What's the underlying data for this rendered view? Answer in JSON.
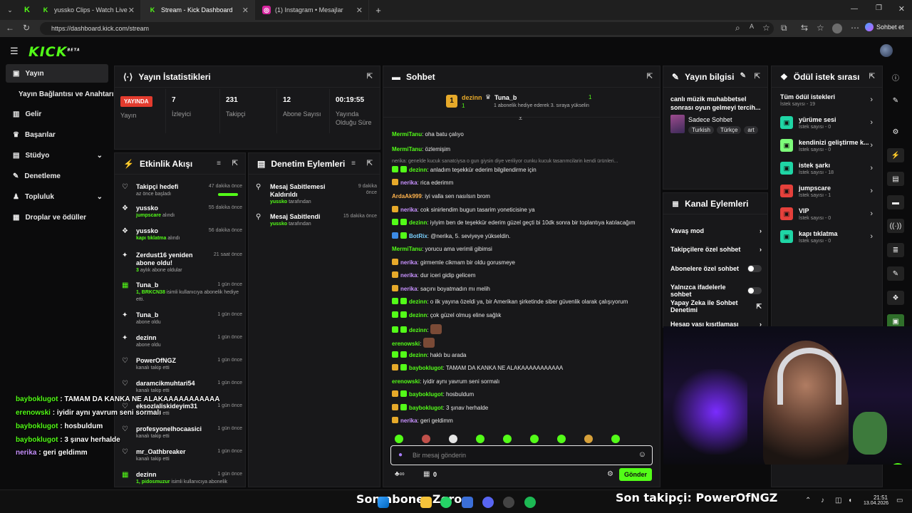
{
  "browser": {
    "tabs": [
      {
        "label": "yussko Clips - Watch Live on K",
        "icon": "kick-icon"
      },
      {
        "label": "Stream - Kick Dashboard",
        "icon": "kick-icon"
      },
      {
        "label": "(1) Instagram • Mesajlar",
        "icon": "instagram-icon"
      }
    ],
    "url": "https://dashboard.kick.com/stream",
    "profile_label": "Sohbet et"
  },
  "app": {
    "logo": "KICK",
    "logo_badge": "BETA"
  },
  "sidebar": {
    "items": [
      {
        "label": "Yayın",
        "icon": "video-icon"
      },
      {
        "label": "Yayın Bağlantısı ve Anahtarı",
        "icon": ""
      },
      {
        "label": "Gelir",
        "icon": "chart-icon"
      },
      {
        "label": "Başarılar",
        "icon": "trophy-icon"
      },
      {
        "label": "Stüdyo",
        "icon": "studio-icon"
      },
      {
        "label": "Denetleme",
        "icon": "wrench-icon"
      },
      {
        "label": "Topluluk",
        "icon": "community-icon"
      },
      {
        "label": "Droplar ve ödüller",
        "icon": "gift-icon"
      }
    ]
  },
  "stats": {
    "title": "Yayın İstatistikleri",
    "live_badge": "YAYINDA",
    "live_label": "Yayın",
    "cols": [
      {
        "value": "7",
        "label": "İzleyici"
      },
      {
        "value": "231",
        "label": "Takipçi"
      },
      {
        "value": "12",
        "label": "Abone Sayısı"
      },
      {
        "value": "00:19:55",
        "label": "Yayında Olduğu Süre"
      }
    ]
  },
  "activity": {
    "title": "Etkinlik Akışı",
    "items": [
      {
        "title": "Takipçi hedefi",
        "sub": "az önce başladı",
        "time": "47 dakika önce"
      },
      {
        "title": "yussko",
        "sub_green": "jumpscare",
        "sub": "alındı",
        "time": "55 dakika önce"
      },
      {
        "title": "yussko",
        "sub_green": "kapı tıklatma",
        "sub": "alındı",
        "time": "56 dakika önce"
      },
      {
        "title": "Zerdust16 yeniden abone oldu!",
        "sub_green": "3",
        "sub": "aylık abone oldular",
        "time": "21 saat önce"
      },
      {
        "title": "Tuna_b",
        "sub_green": "1, BRKCN38",
        "sub": "isimli kullanıcıya abonelik hediye etti.",
        "time": "1 gün önce"
      },
      {
        "title": "Tuna_b",
        "sub": "abone oldu",
        "time": "1 gün önce"
      },
      {
        "title": "dezinn",
        "sub": "abone oldu",
        "time": "1 gün önce"
      },
      {
        "title": "PowerOfNGZ",
        "sub": "kanalı takip etti",
        "time": "1 gün önce"
      },
      {
        "title": "daramcikmuhtari54",
        "sub": "kanalı takip etti",
        "time": "1 gün önce"
      },
      {
        "title": "eksozlaliskideyim31",
        "sub": "kanalı takip etti",
        "time": "1 gün önce"
      },
      {
        "title": "profesyonelhocaasici",
        "sub": "kanalı takip etti",
        "time": "1 gün önce"
      },
      {
        "title": "mr_Oathbreaker",
        "sub": "kanalı takip etti",
        "time": "1 gün önce"
      },
      {
        "title": "dezinn",
        "sub_green": "1, pidosmuzur",
        "sub": "isimli kullanıcıya abonelik",
        "time": "1 gün önce"
      }
    ]
  },
  "moderation": {
    "title": "Denetim Eylemleri",
    "items": [
      {
        "title": "Mesaj Sabitlemesi Kaldırıldı",
        "user": "yussko",
        "sub": "tarafından",
        "time": "9 dakika önce"
      },
      {
        "title": "Mesaj Sabitlendi",
        "user": "yussko",
        "sub": "tarafından",
        "time": "15 dakika önce"
      }
    ]
  },
  "chat": {
    "title": "Sohbet",
    "leader_rank": "1",
    "leader_name": "dezinn",
    "leader_count": "1",
    "top_name": "Tuna_b",
    "top_count": "1",
    "top_note": "1 abonelik hediye ederek 3. sıraya yükselin",
    "reply_note": "nerika: genelde kucuk sanatciysa o gun giysin diye veriliyor cunku kucuk tasarımcilarin kendi ürünleri...",
    "messages": [
      {
        "user": "MermiTanu",
        "text": "oha batu çalıyo",
        "color": "green",
        "badges": []
      },
      {
        "user": "MermiTanu",
        "text": "özlemişim",
        "color": "green",
        "badges": []
      },
      {
        "user": "dezinn",
        "text": "anladım teşekkür ederim bilgilendirme için",
        "color": "green",
        "badges": [
          "green",
          "green"
        ]
      },
      {
        "user": "nerika",
        "text": "rica ederimm",
        "color": "purple",
        "badges": [
          "gold"
        ]
      },
      {
        "user": "ArdaAk999",
        "text": "iyi valla sen nasılsın brom",
        "color": "orange",
        "badges": []
      },
      {
        "user": "nerika",
        "text": "cok sinirlendim bugun tasarim yoneticisine ya",
        "color": "purple",
        "badges": [
          "gold"
        ]
      },
      {
        "user": "dezinn",
        "text": "iyiyim ben de teşekkür ederim güzel geçti bi 10dk sonra bir toplantıya katılacağım",
        "color": "green",
        "badges": [
          "green",
          "green"
        ]
      },
      {
        "user": "BotRix",
        "text": "@nerika, 5. seviyeye yükseldin.",
        "color": "blue",
        "badges": [
          "blue",
          "green"
        ]
      },
      {
        "user": "MermiTanu",
        "text": "yorucu ama verimli gibimsi",
        "color": "green",
        "badges": []
      },
      {
        "user": "nerika",
        "text": "girmemle cikmam bir oldu gorusmeye",
        "color": "purple",
        "badges": [
          "gold"
        ]
      },
      {
        "user": "nerika",
        "text": "dur iceri gidip gelicem",
        "color": "purple",
        "badges": [
          "gold"
        ]
      },
      {
        "user": "nerika",
        "text": "saçını boyatmadın mı melih",
        "color": "purple",
        "badges": [
          "gold"
        ]
      },
      {
        "user": "dezinn",
        "text": "o ilk yayına özeldi ya, bir Amerikan şirketinde siber güvenlik olarak çalışıyorum",
        "color": "green",
        "badges": [
          "green",
          "green"
        ]
      },
      {
        "user": "dezinn",
        "text": "çok güzel olmuş eline sağlık",
        "color": "green",
        "badges": [
          "green",
          "green"
        ]
      },
      {
        "user": "dezinn",
        "text": "",
        "color": "green",
        "badges": [
          "green",
          "green"
        ]
      },
      {
        "user": "erenowski",
        "text": "",
        "color": "green",
        "badges": []
      },
      {
        "user": "dezinn",
        "text": "haklı bu arada",
        "color": "green",
        "badges": [
          "green",
          "green"
        ]
      },
      {
        "user": "bayboklugot",
        "text": "TAMAM DA KANKA NE ALAKAAAAAAAAAAA",
        "color": "green",
        "badges": [
          "gold",
          "green"
        ]
      },
      {
        "user": "erenowski",
        "text": "iyidir aynı yavrum seni sormalı",
        "color": "green",
        "badges": []
      },
      {
        "user": "bayboklugot",
        "text": "hosbuldum",
        "color": "green",
        "badges": [
          "gold",
          "green"
        ]
      },
      {
        "user": "bayboklugot",
        "text": "3 şınav herhalde",
        "color": "green",
        "badges": [
          "gold",
          "green"
        ]
      },
      {
        "user": "nerika",
        "text": "geri geldimm",
        "color": "purple",
        "badges": [
          "gold"
        ]
      }
    ],
    "input_placeholder": "Bir mesaj gönderin",
    "points": "0",
    "send_label": "Gönder"
  },
  "stream_info": {
    "title": "Yayın bilgisi",
    "stream_title": "canlı müzik muhabbetsel sonrası oyun gelmeyi tercih...",
    "category": "Sadece Sohbet",
    "tags": [
      "Turkish",
      "Türkçe",
      "art"
    ]
  },
  "channel_actions": {
    "title": "Kanal Eylemleri",
    "items": [
      {
        "label": "Yavaş mod",
        "kind": "arrow"
      },
      {
        "label": "Takipçilere özel sohbet",
        "kind": "arrow"
      },
      {
        "label": "Abonelere özel sohbet",
        "kind": "toggle"
      },
      {
        "label": "Yalnızca ifadelerle sohbet",
        "kind": "toggle"
      },
      {
        "label": "Yapay Zeka ile Sohbet Denetimi",
        "kind": "external"
      },
      {
        "label": "Hesap yaşı kısıtlaması",
        "kind": "arrow"
      }
    ]
  },
  "rewards": {
    "title": "Ödül istek sırası",
    "items": [
      {
        "name": "Tüm ödül istekleri",
        "count": "İstek sayısı - 19",
        "color": ""
      },
      {
        "name": "yürüme sesi",
        "count": "İstek sayısı - 0",
        "color": "#1fd5a5"
      },
      {
        "name": "kendinizi geliştirme k...",
        "count": "İstek sayısı - 0",
        "color": "#7dfc7a"
      },
      {
        "name": "istek şarkı",
        "count": "İstek sayısı - 18",
        "color": "#1fd5a5"
      },
      {
        "name": "jumpscare",
        "count": "İstek sayısı - 1",
        "color": "#e5403b"
      },
      {
        "name": "VIP",
        "count": "İstek sayısı - 0",
        "color": "#e5403b"
      },
      {
        "name": "kapı tıklatma",
        "count": "İstek sayısı - 0",
        "color": "#1fd5a5"
      }
    ]
  },
  "overlay": {
    "chat": [
      {
        "user": "bayboklugot",
        "text": "TAMAM DA KANKA NE ALAKAAAAAAAAAAA"
      },
      {
        "user": "erenowski",
        "text": "iyidir aynı yavrum seni sormalı"
      },
      {
        "user": "bayboklugot",
        "text": "hosbuldum"
      },
      {
        "user": "bayboklugot",
        "text": "3 şınav herhalde"
      },
      {
        "user": "nerika",
        "text": "geri geldimm"
      }
    ],
    "last_sub": "Son abone: Zero",
    "last_follower": "Son takipçi: PowerOfNGZ"
  },
  "taskbar": {
    "time": "21:51",
    "date": "13.04.2026"
  },
  "colors": {
    "accent": "#53fc18",
    "panel": "#18181a",
    "live": "#e33b2e"
  }
}
